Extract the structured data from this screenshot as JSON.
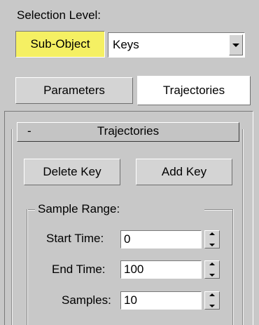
{
  "selection_level": {
    "label": "Selection Level:",
    "sub_object_button": "Sub-Object",
    "dropdown_value": "Keys"
  },
  "tabs": [
    {
      "label": "Parameters",
      "active": false
    },
    {
      "label": "Trajectories",
      "active": true
    }
  ],
  "rollout": {
    "collapse_symbol": "-",
    "title": "Trajectories"
  },
  "buttons": {
    "delete_key": "Delete Key",
    "add_key": "Add Key"
  },
  "sample_range": {
    "title": "Sample Range:",
    "start_time_label": "Start Time:",
    "start_time_value": "0",
    "end_time_label": "End Time:",
    "end_time_value": "100",
    "samples_label": "Samples:",
    "samples_value": "10"
  },
  "colors": {
    "panel_bg": "#c8c8c8",
    "sub_object_highlight": "#f5f063",
    "button_face": "#d4d4d4",
    "field_bg": "#ffffff"
  },
  "icons": {
    "dropdown": "chevron-down-icon",
    "spinner": "spinner-arrows-icon"
  }
}
